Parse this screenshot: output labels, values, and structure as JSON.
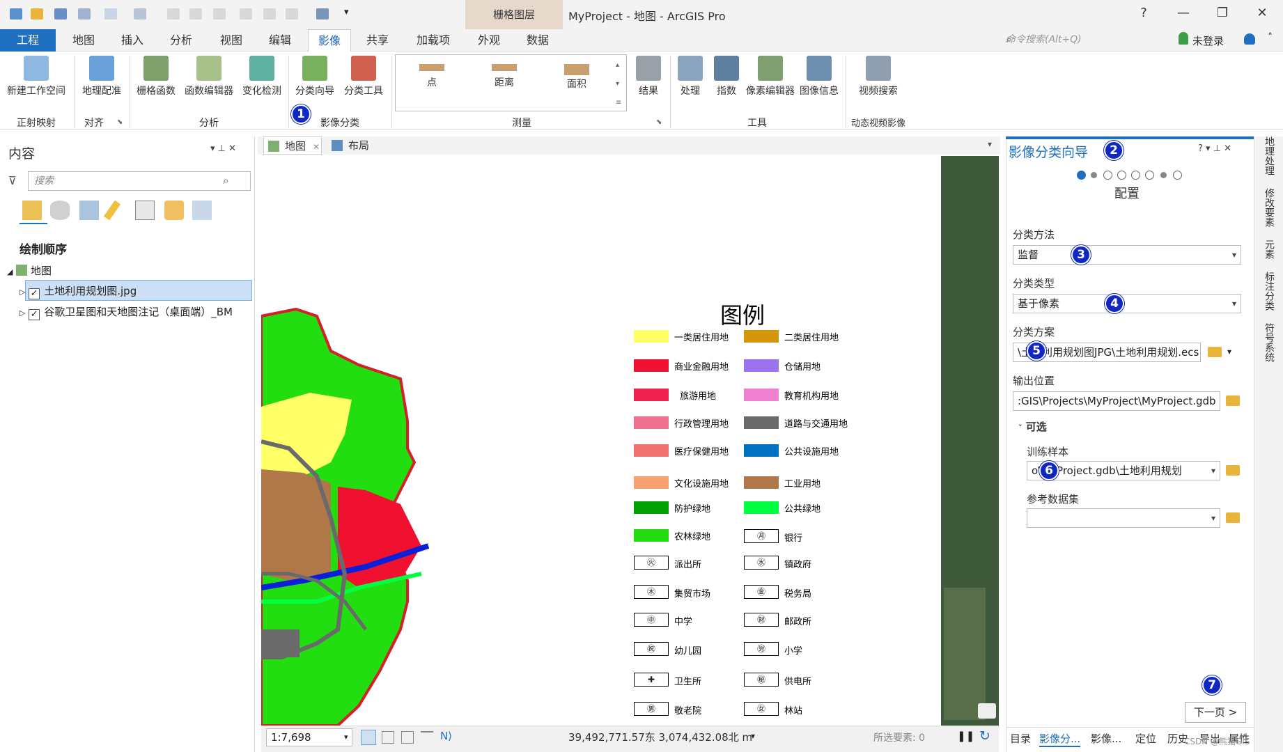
{
  "titlebar": {
    "context_group": "栅格图层",
    "app_title": "MyProject - 地图 - ArcGIS Pro",
    "help": "?",
    "minimize": "—",
    "restore": "❐",
    "close": "✕"
  },
  "tabs": [
    "工程",
    "地图",
    "插入",
    "分析",
    "视图",
    "编辑",
    "影像",
    "共享",
    "加载项",
    "外观",
    "数据"
  ],
  "command_search": {
    "placeholder": "命令搜索(Alt+Q)"
  },
  "signin": "未登录",
  "ribbon": {
    "buttons": [
      "新建工作空间",
      "地理配准",
      "栅格函数",
      "函数编辑器",
      "变化检测",
      "分类向导",
      "分类工具",
      "结果",
      "处理",
      "指数",
      "像素编辑器",
      "图像信息",
      "视频搜索"
    ],
    "gallery": [
      "点",
      "距离",
      "面积"
    ],
    "groups": [
      "正射映射",
      "对齐",
      "分析",
      "影像分类",
      "测量",
      "工具",
      "动态视频影像"
    ]
  },
  "badges": [
    "1",
    "2",
    "3",
    "4",
    "5",
    "6",
    "7"
  ],
  "contents": {
    "title": "内容",
    "search_placeholder": "搜索",
    "draw_order": "绘制顺序",
    "map_node": "地图",
    "layers": [
      "土地利用规划图.jpg",
      "谷歌卫星图和天地图注记（桌面端）_BM"
    ]
  },
  "view_tabs": [
    "地图",
    "布局"
  ],
  "legend": {
    "title": "图例",
    "items": [
      {
        "label": "一类居住用地",
        "color": "#ffff66"
      },
      {
        "label": "二类居住用地",
        "color": "#d4960a"
      },
      {
        "label": "商业金融用地",
        "color": "#f01030"
      },
      {
        "label": "仓储用地",
        "color": "#9b72f0"
      },
      {
        "label": "旅游用地",
        "color": "#f02050"
      },
      {
        "label": "教育机构用地",
        "color": "#f080d0"
      },
      {
        "label": "行政管理用地",
        "color": "#f07090"
      },
      {
        "label": "道路与交通用地",
        "color": "#6a6a6a"
      },
      {
        "label": "医疗保健用地",
        "color": "#f07070"
      },
      {
        "label": "公共设施用地",
        "color": "#0070c0"
      },
      {
        "label": "文化设施用地",
        "color": "#f8a070"
      },
      {
        "label": "工业用地",
        "color": "#b07848"
      },
      {
        "label": "防护绿地",
        "color": "#00a000"
      },
      {
        "label": "公共绿地",
        "color": "#00ff40"
      },
      {
        "label": "农林绿地",
        "color": "#22dd10"
      },
      {
        "label": "银行",
        "symbol": "㊊"
      },
      {
        "label": "派出所",
        "symbol": "㊋"
      },
      {
        "label": "镇政府",
        "symbol": "㊌"
      },
      {
        "label": "集贸市场",
        "symbol": "㊍"
      },
      {
        "label": "税务局",
        "symbol": "㊎"
      },
      {
        "label": "中学",
        "symbol": "㊥"
      },
      {
        "label": "邮政所",
        "symbol": "㊖"
      },
      {
        "label": "幼儿园",
        "symbol": "㊗"
      },
      {
        "label": "小学",
        "symbol": "㊘"
      },
      {
        "label": "卫生所",
        "symbol": "✚"
      },
      {
        "label": "供电所",
        "symbol": "㊙"
      },
      {
        "label": "敬老院",
        "symbol": "㊚"
      },
      {
        "label": "林站",
        "symbol": "㊛"
      }
    ]
  },
  "status": {
    "scale": "1:7,698",
    "coords": "39,492,771.57东 3,074,432.08北 m",
    "selected": "所选要素: 0"
  },
  "wizard": {
    "title": "影像分类向导",
    "step": "配置",
    "method_label": "分类方法",
    "method_value": "监督",
    "type_label": "分类类型",
    "type_value": "基于像素",
    "schema_label": "分类方案",
    "schema_value": "\\土地利用规划图JPG\\土地利用规划.ecs",
    "output_label": "输出位置",
    "output_value": ":GIS\\Projects\\MyProject\\MyProject.gdb",
    "optional": "可选",
    "training_label": "训练样本",
    "training_value": "o\\MyProject.gdb\\土地利用规划",
    "ref_label": "参考数据集",
    "ref_value": "",
    "next": "下一页 >"
  },
  "bottom_tabs": [
    "目录",
    "影像分...",
    "影像...",
    "定位",
    "历史",
    "导出",
    "属性"
  ],
  "side_strip": [
    "地理处理",
    "修改要素",
    "元素",
    "标注分类",
    "符号系统"
  ],
  "watermark": "CSDN @熊猫GIS"
}
